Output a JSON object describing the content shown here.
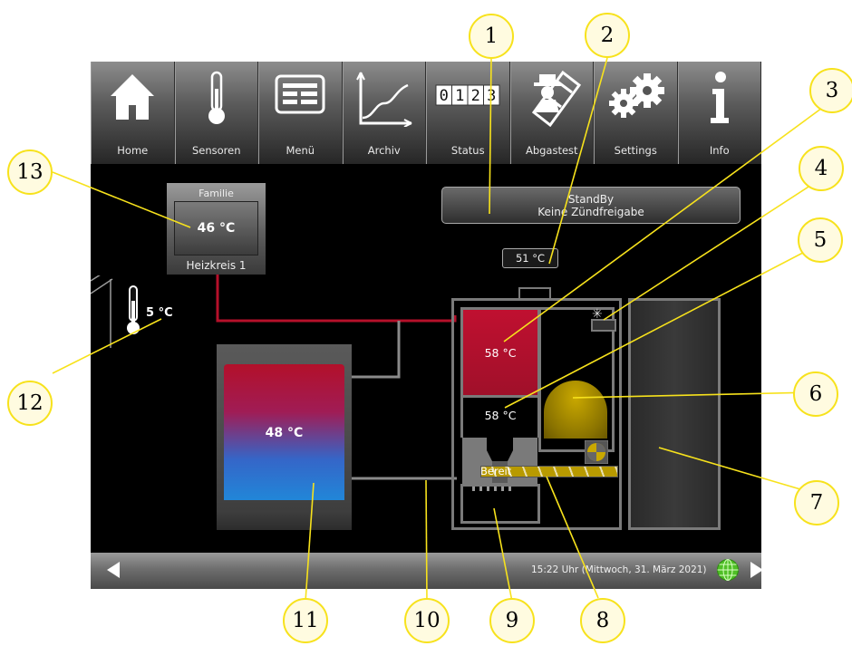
{
  "nav": [
    {
      "label": "Home",
      "icon": "home-icon"
    },
    {
      "label": "Sensoren",
      "icon": "thermometer-icon"
    },
    {
      "label": "Menü",
      "icon": "menu-icon"
    },
    {
      "label": "Archiv",
      "icon": "chart-icon"
    },
    {
      "label": "Status",
      "icon": "status-counter-icon",
      "digits": "0123"
    },
    {
      "label": "Abgastest",
      "icon": "chimney-sweep-icon"
    },
    {
      "label": "Settings",
      "icon": "gears-icon"
    },
    {
      "label": "Info",
      "icon": "info-icon"
    }
  ],
  "heating_circuit": {
    "mode": "Familie",
    "temperature": "46 °C",
    "name": "Heizkreis 1"
  },
  "outdoor": {
    "temperature": "5 °C"
  },
  "status": {
    "line1": "StandBy",
    "line2": "Keine Zündfreigabe"
  },
  "flue_gas": {
    "temperature": "51 °C"
  },
  "boiler": {
    "top_temperature": "58 °C",
    "lower_temperature": "58 °C",
    "feeder_status": "Bereit"
  },
  "buffer": {
    "temperature": "48 °C"
  },
  "footer": {
    "datetime": "15:22 Uhr (Mittwoch, 31. März 2021)"
  },
  "callouts": [
    "1",
    "2",
    "3",
    "4",
    "5",
    "6",
    "7",
    "8",
    "9",
    "10",
    "11",
    "12",
    "13"
  ],
  "colors": {
    "callout_border": "#f7e21c",
    "callout_fill": "#fffbe0",
    "pipe_red": "#b5102a",
    "pipe_gray": "#8a8a8a",
    "fire": "#a38a00"
  }
}
